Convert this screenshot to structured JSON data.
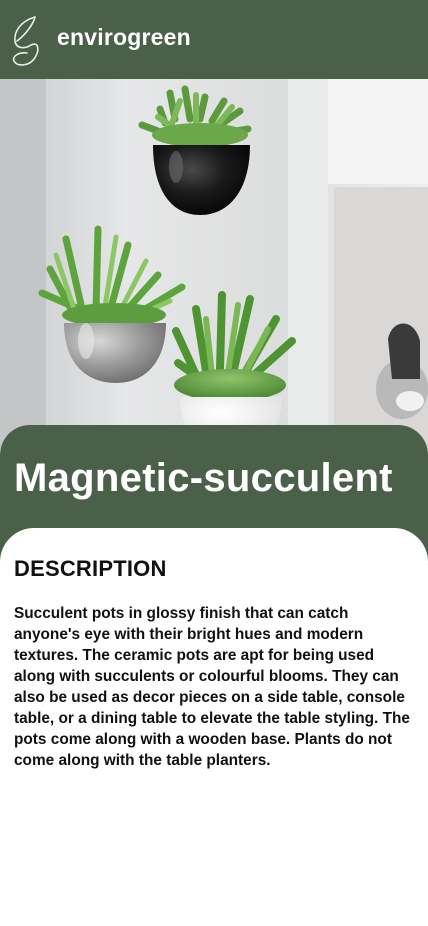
{
  "header": {
    "brand": "envirogreen",
    "logo_icon": "leaf-logo-icon"
  },
  "hero_image": {
    "alt": "Magnetic-succulent"
  },
  "product": {
    "title": "Magnetic-succulent"
  },
  "description": {
    "heading": "DESCRIPTION",
    "body": "Succulent pots in glossy finish that can catch anyone's eye with their bright hues and modern textures. The ceramic pots are apt for being used along with succulents or colourful blooms. They can also be used as decor pieces on a side table, console table, or a dining table to elevate the table styling. The pots come along with a wooden base. Plants do not come along with the table planters."
  },
  "colors": {
    "brand_green": "#4a6049",
    "background": "#ffffff",
    "text": "#111111"
  }
}
